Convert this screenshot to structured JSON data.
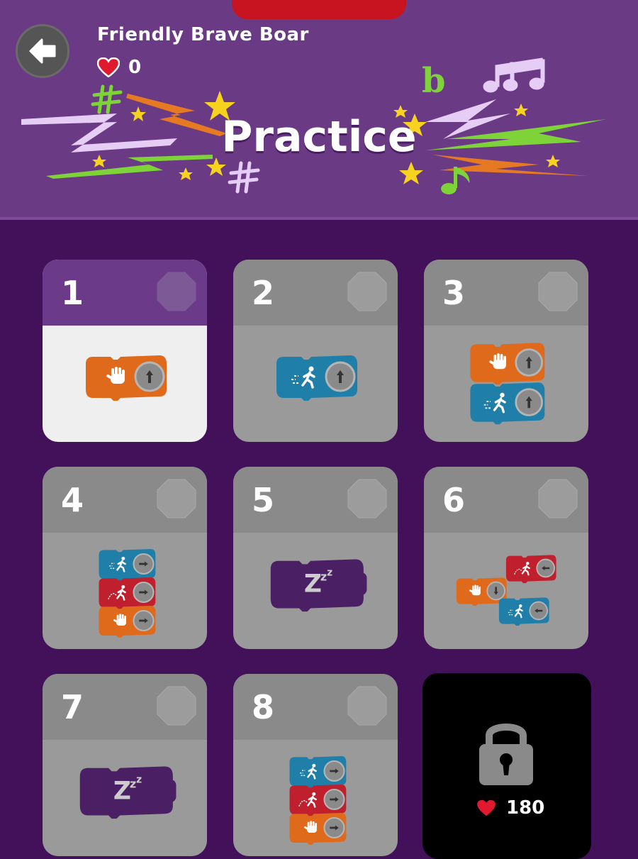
{
  "header": {
    "player_name": "Friendly Brave Boar",
    "hearts": "0",
    "title": "Practice"
  },
  "levels": [
    {
      "number": "1",
      "state": "selected",
      "blocks": [
        "hand-up"
      ]
    },
    {
      "number": "2",
      "state": "unlocked",
      "blocks": [
        "run-up"
      ]
    },
    {
      "number": "3",
      "state": "unlocked",
      "blocks": [
        "hand-up",
        "run-up"
      ]
    },
    {
      "number": "4",
      "state": "unlocked",
      "blocks": [
        "run-right",
        "jump-right",
        "hand-right"
      ]
    },
    {
      "number": "5",
      "state": "unlocked",
      "blocks": [
        "sleep"
      ]
    },
    {
      "number": "6",
      "state": "unlocked",
      "blocks": [
        "jump-left",
        "hand-down",
        "run-left"
      ]
    },
    {
      "number": "7",
      "state": "unlocked",
      "blocks": [
        "sleep"
      ]
    },
    {
      "number": "8",
      "state": "unlocked",
      "blocks": [
        "run-right",
        "jump-right",
        "hand-right"
      ]
    }
  ],
  "locked_level": {
    "cost": "180",
    "icon": "padlock-icon"
  },
  "colors": {
    "header_bg": "#6a3a84",
    "page_bg": "#43105a",
    "heart": "#e0192e",
    "block_orange": "#e06a1b",
    "block_blue": "#1f7fa8",
    "block_red": "#c0202d",
    "block_purple": "#4a1f64",
    "locked_bg": "#000000"
  }
}
